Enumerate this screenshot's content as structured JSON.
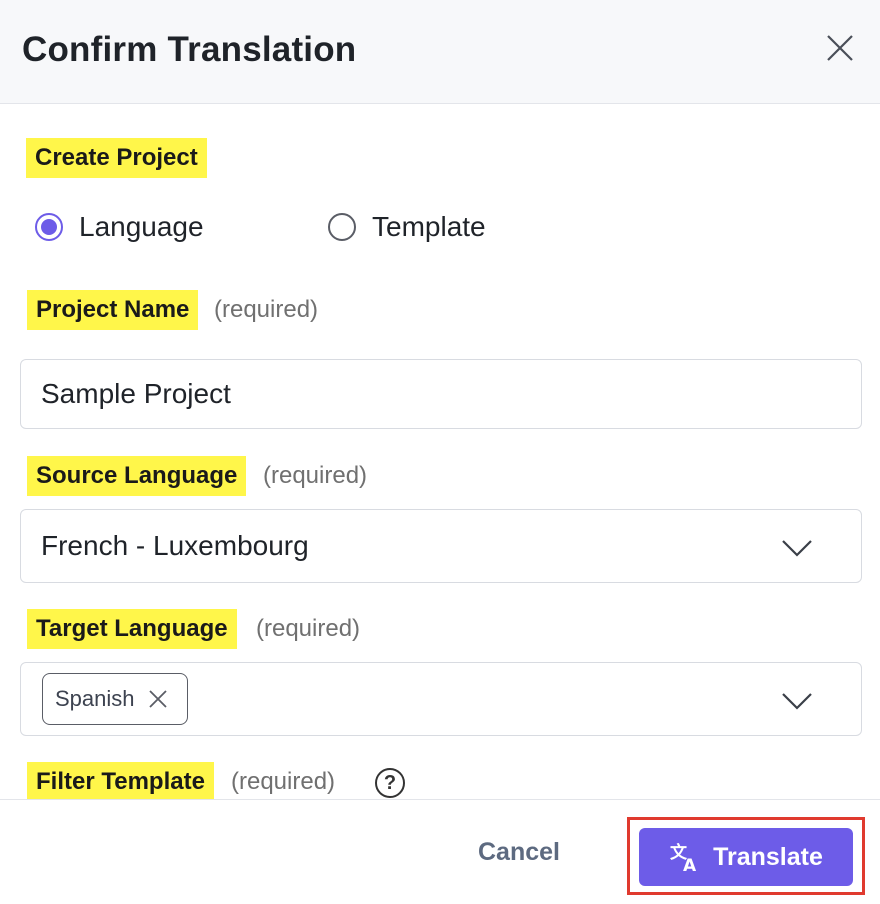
{
  "header": {
    "title": "Confirm Translation"
  },
  "create_project": {
    "label": "Create Project",
    "options": [
      {
        "label": "Language",
        "checked": true
      },
      {
        "label": "Template",
        "checked": false
      }
    ]
  },
  "project_name": {
    "label": "Project Name",
    "required": "(required)",
    "value": "Sample Project"
  },
  "source_language": {
    "label": "Source Language",
    "required": "(required)",
    "value": "French - Luxembourg"
  },
  "target_language": {
    "label": "Target Language",
    "required": "(required)",
    "chips": [
      "Spanish"
    ]
  },
  "filter_template": {
    "label": "Filter Template",
    "required": "(required)",
    "help": "?"
  },
  "footer": {
    "cancel": "Cancel",
    "translate": "Translate"
  },
  "colors": {
    "accent": "#6d5ce8",
    "highlight": "#fff64a",
    "outline": "#e03a2f"
  }
}
